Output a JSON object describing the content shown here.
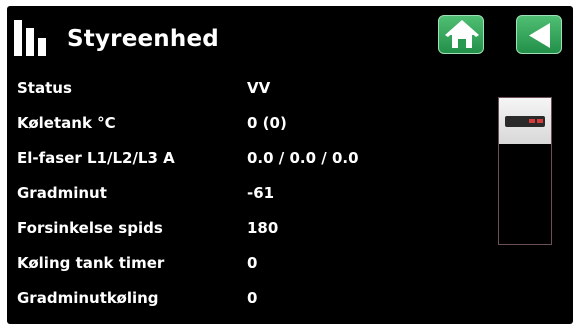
{
  "header": {
    "title": "Styreenhed",
    "logo_icon": "bars-logo-icon",
    "home_icon": "home-icon",
    "back_icon": "back-arrow-icon",
    "button_color": "#2fa35a"
  },
  "rows": [
    {
      "label": "Status",
      "value": "VV"
    },
    {
      "label": "Køletank °C",
      "value": "0 (0)"
    },
    {
      "label": "El-faser L1/L2/L3 A",
      "value": "0.0 / 0.0 / 0.0"
    },
    {
      "label": "Gradminut",
      "value": "-61"
    },
    {
      "label": "Forsinkelse spids",
      "value": "180"
    },
    {
      "label": "Køling tank timer",
      "value": "0"
    },
    {
      "label": "Gradminutkøling",
      "value": "0"
    }
  ],
  "unit_image": "heat-pump-unit-icon"
}
